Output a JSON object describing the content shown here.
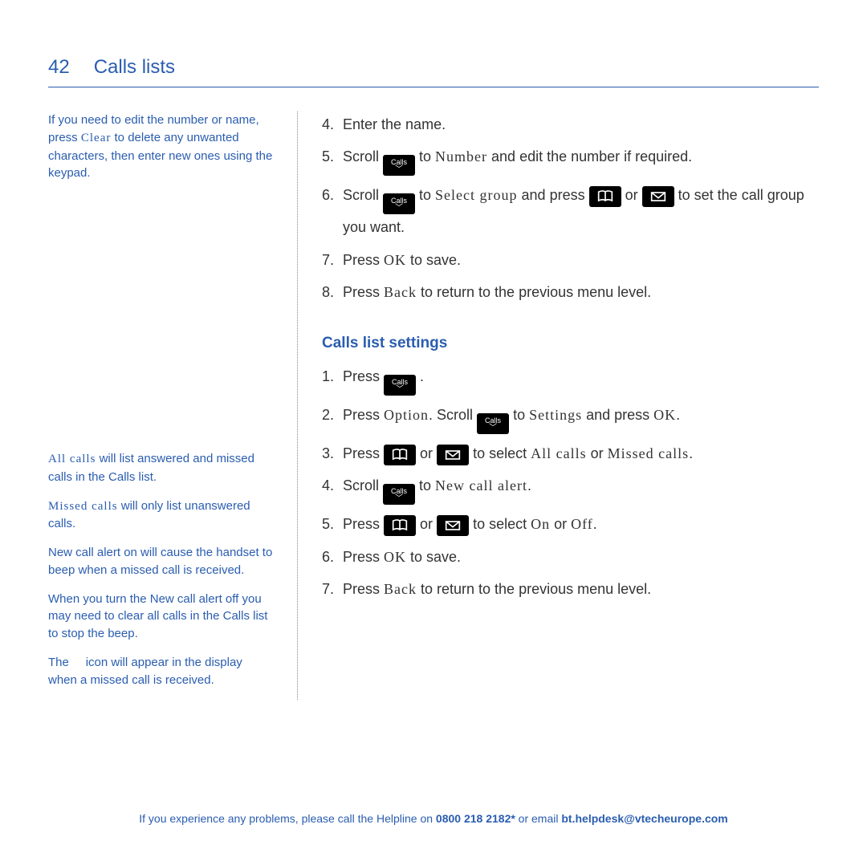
{
  "page_number": "42",
  "section_title": "Calls lists",
  "sidebar": {
    "p1_a": "If you need to edit the number or name, press ",
    "p1_clear": "Clear",
    "p1_b": " to delete any unwanted characters, then enter new ones using the keypad.",
    "p2_all": "All calls",
    "p2_rest": " will list answered and missed calls in the Calls list.",
    "p3_missed": "Missed calls",
    "p3_rest": " will only list unanswered calls.",
    "p4": "New call alert on will cause the handset to beep when a missed call is received.",
    "p5": "When you turn the New call alert off you may need to clear all calls in the Calls list to stop the beep.",
    "p6_a": "The ",
    "p6_b": " icon will appear in the display when a missed call is received."
  },
  "steps_a": {
    "s4": {
      "n": "4.",
      "text": "Enter the name."
    },
    "s5": {
      "n": "5.",
      "a": "Scroll ",
      "b": " to ",
      "num": "Number",
      "c": " and edit the number if required."
    },
    "s6": {
      "n": "6.",
      "a": "Scroll ",
      "b": " to ",
      "sel": "Select group",
      "c": " and press ",
      "d": " or ",
      "e": " to set the call group you want."
    },
    "s7": {
      "n": "7.",
      "a": "Press ",
      "ok": "OK",
      "b": " to save."
    },
    "s8": {
      "n": "8.",
      "a": "Press ",
      "back": "Back",
      "b": " to return to the previous menu level."
    }
  },
  "subheading": "Calls list settings",
  "steps_b": {
    "s1": {
      "n": "1.",
      "a": "Press ",
      "b": "."
    },
    "s2": {
      "n": "2.",
      "a": "Press ",
      "opt": "Option",
      "b": ". Scroll ",
      "c": " to ",
      "set": "Settings",
      "d": " and press ",
      "ok": "OK",
      "e": "."
    },
    "s3": {
      "n": "3.",
      "a": "Press ",
      "b": " or ",
      "c": " to select ",
      "all": "All calls",
      "d": " or ",
      "miss": "Missed calls",
      "e": "."
    },
    "s4": {
      "n": "4.",
      "a": "Scroll ",
      "b": " to ",
      "nca": "New call alert",
      "c": "."
    },
    "s5": {
      "n": "5.",
      "a": "Press ",
      "b": " or ",
      "c": " to select ",
      "on": "On",
      "d": " or ",
      "off": "Off",
      "e": "."
    },
    "s6": {
      "n": "6.",
      "a": "Press ",
      "ok": "OK",
      "b": " to save."
    },
    "s7": {
      "n": "7.",
      "a": "Press ",
      "back": "Back",
      "b": " to return to the previous menu level."
    }
  },
  "key_calls_label": "Calls",
  "footer": {
    "a": "If you experience any problems, please call the Helpline on ",
    "phone": "0800 218 2182*",
    "b": " or email ",
    "email": "bt.helpdesk@vtecheurope.com"
  }
}
